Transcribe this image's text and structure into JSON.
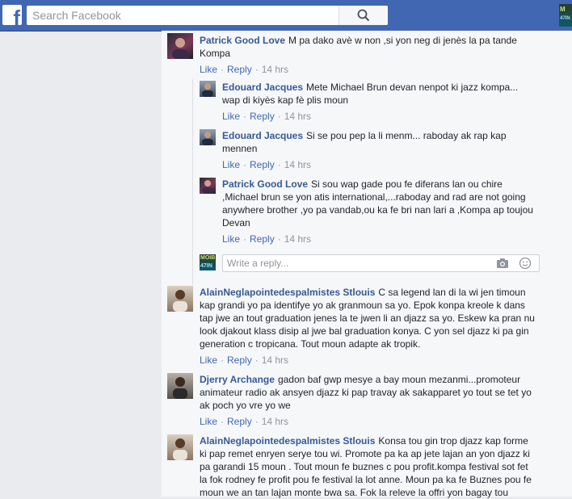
{
  "header": {
    "logo_letter": "f",
    "search_placeholder": "Search Facebook",
    "badge_top": "M",
    "badge_bottom": "47IN"
  },
  "comments": [
    {
      "author": "Patrick Good Love",
      "text": "M pa dako avè w non ,si yon neg di jenès la pa tande Kompa",
      "like": "Like",
      "reply": "Reply",
      "time": "14 hrs",
      "replies": [
        {
          "author": "Edouard Jacques",
          "text": "Mete Michael Brun devan nenpot ki jazz kompa... wap di kiyès kap fè plis moun",
          "like": "Like",
          "reply": "Reply",
          "time": "14 hrs"
        },
        {
          "author": "Edouard Jacques",
          "text": "Si se pou pep la li menm... raboday ak rap kap mennen",
          "like": "Like",
          "reply": "Reply",
          "time": "14 hrs"
        },
        {
          "author": "Patrick Good Love",
          "text": "Si sou wap gade pou fe diferans lan ou chire ,Michael brun se yon atis international,...raboday and rad are not going anywhere brother ,yo pa vandab,ou ka fe bri nan lari a ,Kompa ap toujou Devan",
          "like": "Like",
          "reply": "Reply",
          "time": "14 hrs"
        }
      ],
      "reply_placeholder": "Write a reply...",
      "reply_avatar_top": "MOIB",
      "reply_avatar_bottom": "47IN"
    },
    {
      "author": "AlainNeglapointedespalmistes Stlouis",
      "text": "C sa legend lan di la wi jen timoun kap grandi yo pa identifye yo ak granmoun sa yo. Epok konpa kreole k dans tap jwe an tout graduation jenes la te jwen li an djazz sa yo. Eskew ka pran nu look djakout klass disip al jwe bal graduation konya. C yon sel djazz ki pa gin generation c tropicana. Tout moun adapte ak tropik.",
      "like": "Like",
      "reply": "Reply",
      "time": "14 hrs"
    },
    {
      "author": "Djerry Archange",
      "text": "gadon baf gwp mesye a bay moun mezanmi...promoteur animateur radio ak ansyen djazz ki pap travay ak sakapparet yo tout se tet yo ak poch yo vre yo we",
      "like": "Like",
      "reply": "Reply",
      "time": "14 hrs"
    },
    {
      "author": "AlainNeglapointedespalmistes Stlouis",
      "text": "Konsa tou gin trop djazz kap forme ki pap remet enryen serye tou wi. Promote pa ka ap jete lajan an yon djazz ki pa garandi 15 moun . Tout moun fe buznes c pou profit.kompa festival sot fet la fok rodney fe profit pou fe festival la lot anne. Moun pa ka fe Buznes pou fe moun we an tan lajan monte bwa sa. Fok la releve la offri yon bagay tou"
    }
  ],
  "colors": {
    "topbar": "#4267b2",
    "link": "#365899",
    "meta": "#90949c"
  }
}
